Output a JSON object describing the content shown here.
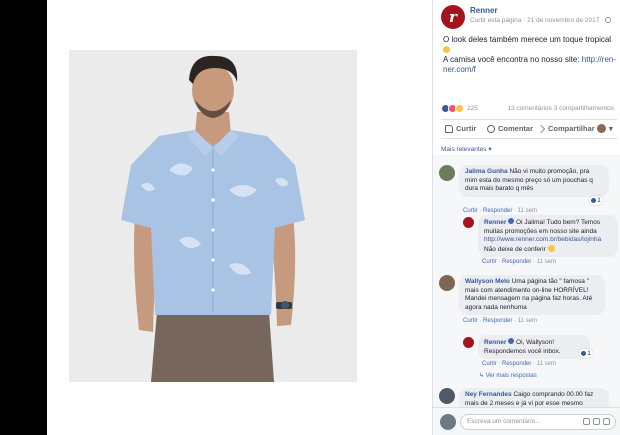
{
  "post": {
    "page_name": "Renner",
    "like_page": "Curtir esta página",
    "date": "21 de novembro de 2017",
    "caption_line1": "O look deles também merece um toque tropical",
    "caption_line2": "A camisa você encontra no nosso site:",
    "caption_link": "http://ren-ner.com/f",
    "reaction_count": "225",
    "stats": "13 comentários  3 compartilhamentos"
  },
  "actions": {
    "like": "Curtir",
    "comment": "Comentar",
    "share": "Compartilhar"
  },
  "sort_label": "Mais relevantes ▾",
  "comments": [
    {
      "author": "Jalima Gunha",
      "text": "Não vi muito promoção, pra mim esta do mesmo preço só um pouchas q dura mais barato q mês",
      "reply": "Curtir",
      "respond": "Responder",
      "time": "11 sem",
      "reaction": "1"
    },
    {
      "author": "Renner",
      "text": "Oi Jalima! Tudo bem? Temos muitas promoções em nosso site ainda",
      "link": "http://www.renner.com.br/bebidas/lojinha",
      "tail": "Não deixe de conferir",
      "reply": "Curtir",
      "respond": "Responder",
      "time": "11 sem"
    },
    {
      "author": "Wallyson Melo",
      "text": "Uma página tão \" famosa \" mais com atendimento on-line HORRÍVEL! Mandei mensagem na página faz horas. Até agora nada nenhuma",
      "reply": "Curtir",
      "respond": "Responder",
      "time": "11 sem"
    },
    {
      "author": "Renner",
      "text": "Oi, Wallyson! Respondemos você inbox.",
      "reply": "Curtir",
      "respond": "Responder",
      "time": "11 sem",
      "reaction": "1"
    },
    {
      "author": "Ney Fernandes",
      "text": "Caigo comprando 00.00 faz mais de 2 meses e já vi por esse mesmo"
    }
  ],
  "more_replies": "Ver mais respostas",
  "composer_placeholder": "Escreva um comentário..."
}
